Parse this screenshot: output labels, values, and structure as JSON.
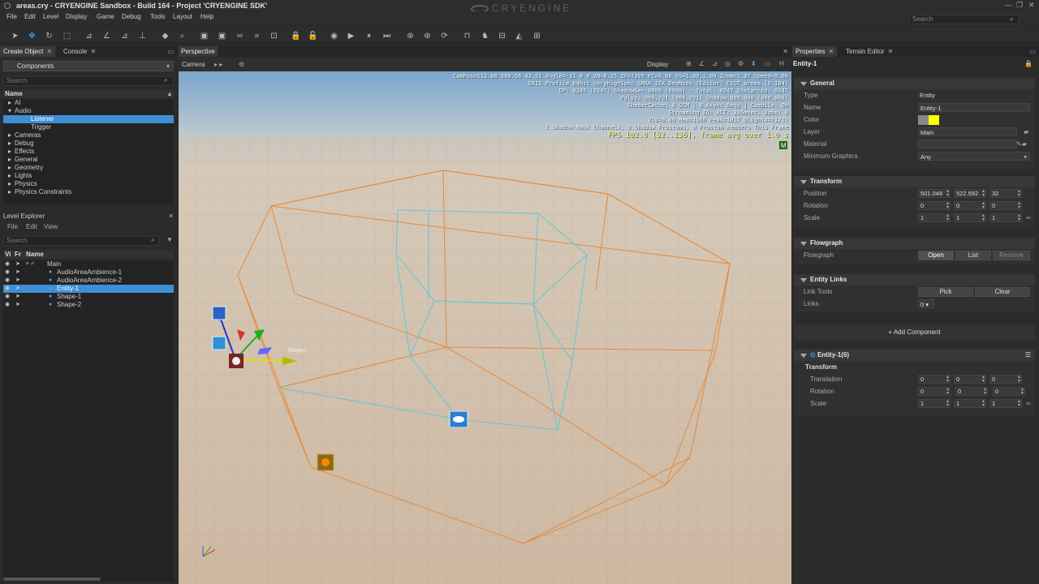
{
  "window": {
    "title": "areas.cry - CRYENGINE Sandbox - Build 164 - Project 'CRYENGINE SDK'",
    "logo": "CRYENGINE",
    "search_placeholder": "Search"
  },
  "menu": [
    "File",
    "Edit",
    "Level",
    "Display",
    "Game",
    "Debug",
    "Tools",
    "Layout",
    "Help"
  ],
  "create_object": {
    "tab": "Create Object",
    "tab2": "Console",
    "combo": "Components",
    "search_placeholder": "Search",
    "column": "Name",
    "items": [
      {
        "label": "AI",
        "expand": "▸",
        "indent": 0
      },
      {
        "label": "Audio",
        "expand": "▾",
        "indent": 0
      },
      {
        "label": "Listener",
        "expand": "",
        "indent": 2,
        "selected": true
      },
      {
        "label": "Trigger",
        "expand": "",
        "indent": 2
      },
      {
        "label": "Cameras",
        "expand": "▸",
        "indent": 0
      },
      {
        "label": "Debug",
        "expand": "▸",
        "indent": 0
      },
      {
        "label": "Effects",
        "expand": "▸",
        "indent": 0
      },
      {
        "label": "General",
        "expand": "▸",
        "indent": 0
      },
      {
        "label": "Geometry",
        "expand": "▸",
        "indent": 0
      },
      {
        "label": "Lights",
        "expand": "▸",
        "indent": 0
      },
      {
        "label": "Physics",
        "expand": "▸",
        "indent": 0
      },
      {
        "label": "Physics Constraints",
        "expand": "▸",
        "indent": 0
      }
    ]
  },
  "level_explorer": {
    "title": "Level Explorer",
    "menu": [
      "File",
      "Edit",
      "View"
    ],
    "search_placeholder": "Search",
    "columns": [
      "Vi",
      "Fr",
      "Name"
    ],
    "items": [
      {
        "label": "Main",
        "indent": 0
      },
      {
        "label": "AudioAreaAmbience-1",
        "indent": 1
      },
      {
        "label": "AudioAreaAmbience-2",
        "indent": 1
      },
      {
        "label": "Entity-1",
        "indent": 1,
        "selected": true
      },
      {
        "label": "Shape-1",
        "indent": 1
      },
      {
        "label": "Shape-2",
        "indent": 1
      }
    ]
  },
  "viewport": {
    "tab": "Perspective",
    "camera": "Camera",
    "display": "Display",
    "hud": [
      "CamPos=512.08 508.56 42.51 Angle=-31  0   0 ZN=0.25 ZF=7399 FC=0.00 VS=1.00,1.00 Zoom=1.07 Speed=0.00",
      "DX11 Profile 64bit VeryHighSpec SMAA 1TX DevMode (Editor) CtGT areas [0.164]",
      "DP: 9247 (9247) ShadowGen:0000 (0000) - Total: 0247 Instanced: 0247",
      "Polys: 966,791 (966,791) Shadow:000,000 (000,000)",
      "ShaderCache: 0 GCM | 0 Async Reqs | Compile: On",
      "Streaming IO: ACT: 286msec, Jobs: 0",
      "Vid=0.00 Mem=1566 Peak=1817 DLights=(1/1)",
      "1 Shadow Mask Channels,   0 Shadow Frustums,   0 Frustum Renders This Frame"
    ],
    "fps": "FPS 102.8 [52..136], frame avg over 1.0 s",
    "gizmo_label": "Shape1"
  },
  "properties": {
    "tab": "Properties",
    "tab2": "Terrain Editor",
    "entity": "Entity-1",
    "general": {
      "title": "General",
      "type_label": "Type",
      "type": "Entity",
      "name_label": "Name",
      "name": "Entity-1",
      "color_label": "Color",
      "color": "#ffff00",
      "layer_label": "Layer",
      "layer": "Main",
      "material_label": "Material",
      "material": "",
      "mingfx_label": "Minimum Graphics",
      "mingfx": "Any"
    },
    "transform": {
      "title": "Transform",
      "position_label": "Position",
      "position": [
        "501.048",
        "522.592",
        "32"
      ],
      "rotation_label": "Rotation",
      "rotation": [
        "0",
        "0",
        "0"
      ],
      "scale_label": "Scale",
      "scale": [
        "1",
        "1",
        "1"
      ]
    },
    "flowgraph": {
      "title": "Flowgraph",
      "label": "Flowgraph",
      "open": "Open",
      "list": "List",
      "remove": "Remove"
    },
    "links": {
      "title": "Entity Links",
      "tools_label": "Link Tools",
      "pick": "Pick",
      "clear": "Clear",
      "links_label": "Links",
      "links_value": "0"
    },
    "add_component": "Add Component",
    "component": {
      "title": "Entity-1(6)",
      "sub": "Transform",
      "translation_label": "Translation",
      "translation": [
        "0",
        "0",
        "0"
      ],
      "rotation_label": "Rotation",
      "rotation": [
        "0",
        "0",
        "0"
      ],
      "scale_label": "Scale",
      "scale": [
        "1",
        "1",
        "1"
      ]
    }
  }
}
